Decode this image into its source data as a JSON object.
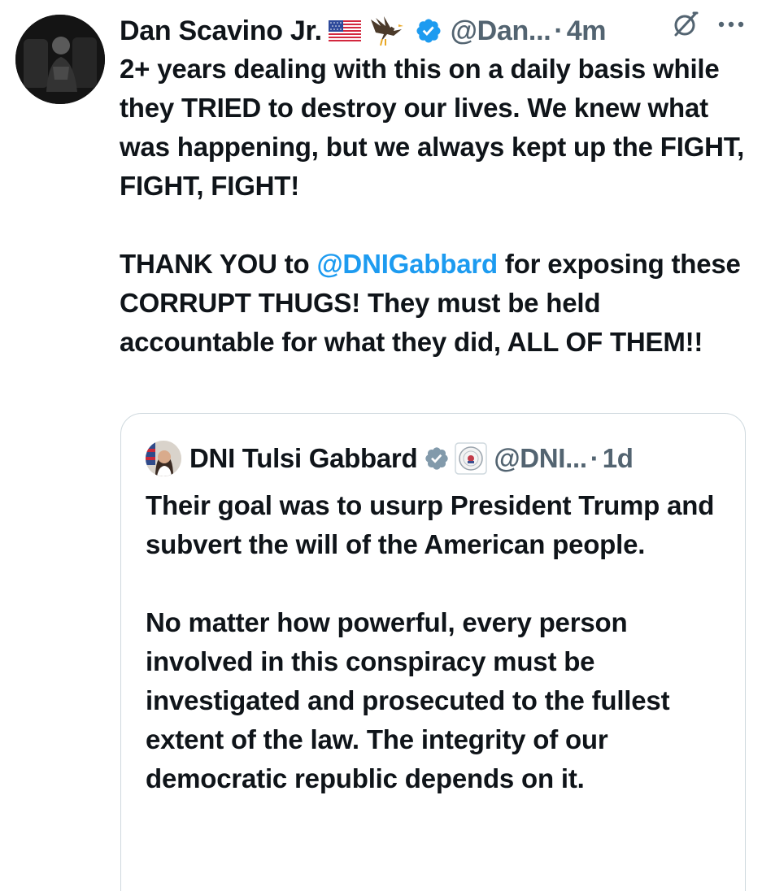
{
  "tweet": {
    "author_name": "Dan Scavino Jr.",
    "emoji_flag": "flag-us-icon",
    "emoji_eagle": "eagle-icon",
    "handle": "@Dan...",
    "separator": "·",
    "time": "4m",
    "body": {
      "p1": "2+ years dealing with this on a daily basis while they TRIED to destroy our lives. We knew what was happening, but we always kept up the FIGHT, FIGHT, FIGHT!",
      "p2_before": "THANK YOU to ",
      "p2_mention": "@DNIGabbard",
      "p2_after": " for exposing these CORRUPT THUGS! They must be held accountable for what they did, ALL OF THEM!!"
    }
  },
  "quote": {
    "author_name": "DNI Tulsi Gabbard",
    "handle": "@DNI...",
    "separator": "·",
    "time": "1d",
    "body": {
      "p1": "Their goal was to usurp President Trump and subvert the will of the American people.",
      "p2": "No matter how powerful, every person involved in this conspiracy must be investigated and prosecuted to the fullest extent of the law. The integrity of our democratic republic depends on it."
    }
  },
  "colors": {
    "text": "#0f1419",
    "secondary": "#536471",
    "link": "#1d9bf0",
    "border": "#cfd9de",
    "verified_blue": "#1d9bf0",
    "verified_gray": "#829aab"
  }
}
